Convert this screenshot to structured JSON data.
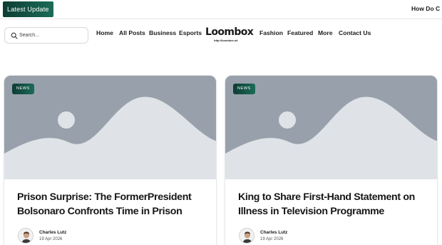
{
  "topbar": {
    "latest_label": "Latest Update",
    "ticker_text": "How Do C"
  },
  "search": {
    "placeholder": "Search..."
  },
  "nav": {
    "left": [
      "Home",
      "All Posts",
      "Business",
      "Esports"
    ],
    "right": [
      "Fashion",
      "Featured",
      "More",
      "Contact Us"
    ]
  },
  "logo": {
    "text": "Loombox",
    "url": "http://loombox.uk"
  },
  "posts": [
    {
      "category": "NEWS",
      "title": "Prison Surprise: The FormerPresident Bolsonaro Confronts Time in Prison",
      "author": "Charles Lutz",
      "date": "19 Apr 2026"
    },
    {
      "category": "NEWS",
      "title": "King to Share First-Hand Statement on Illness in Television Programme",
      "author": "Charles Lutz",
      "date": "19 Apr 2026"
    }
  ],
  "colors": {
    "accent": "#145847",
    "image_placeholder": "#98a1ab",
    "image_placeholder_light": "#dfe3e8"
  },
  "icons": {
    "search": "search-icon",
    "image": "image-placeholder-icon",
    "avatar": "author-avatar"
  }
}
